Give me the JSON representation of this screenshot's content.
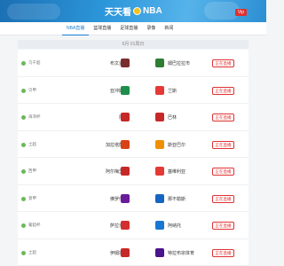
{
  "header": {
    "logo_text": "天天看",
    "logo_suffix": "NBA",
    "vip_label": "Vip"
  },
  "nav": {
    "tabs": [
      {
        "label": "NBA直播",
        "active": true
      },
      {
        "label": "篮球直播",
        "active": false
      },
      {
        "label": "足球直播",
        "active": false
      },
      {
        "label": "录像",
        "active": false
      },
      {
        "label": "新闻",
        "active": false
      }
    ]
  },
  "date_label": "6月 01周日",
  "matches": [
    {
      "league": "乌干超",
      "home": "布文迪巴",
      "away": "姆巴拉拉市",
      "home_color": "#7a2d2d",
      "away_color": "#2e7d32",
      "action": "正在直播"
    },
    {
      "league": "贝甲",
      "home": "亚冲斯里",
      "away": "兰斯",
      "home_color": "#1e8f4a",
      "away_color": "#e53935",
      "action": "正在直播"
    },
    {
      "league": "海湾杯",
      "home": "阿曼",
      "away": "巴林",
      "home_color": "#c62828",
      "away_color": "#c62828",
      "action": "正在直播"
    },
    {
      "league": "土超",
      "home": "加拉塔萨雷",
      "away": "斯亚巴尔",
      "home_color": "#d84315",
      "away_color": "#ef8f00",
      "action": "正在直播"
    },
    {
      "league": "西甲",
      "home": "阿尔梅里亚",
      "away": "塞维利亚",
      "home_color": "#c62828",
      "away_color": "#e53935",
      "action": "正在直播"
    },
    {
      "league": "意甲",
      "home": "佛罗伦萨",
      "away": "那不勒斯",
      "home_color": "#6a1b9a",
      "away_color": "#1565c0",
      "action": "正在直播"
    },
    {
      "league": "葡超杯",
      "home": "萨拉米斯",
      "away": "阿纳托",
      "home_color": "#d32f2f",
      "away_color": "#1976d2",
      "action": "正在直播"
    },
    {
      "league": "土超",
      "home": "伊姆拉兹",
      "away": "特拉布宗体育",
      "home_color": "#c62828",
      "away_color": "#4a148c",
      "action": "正在直播"
    }
  ]
}
